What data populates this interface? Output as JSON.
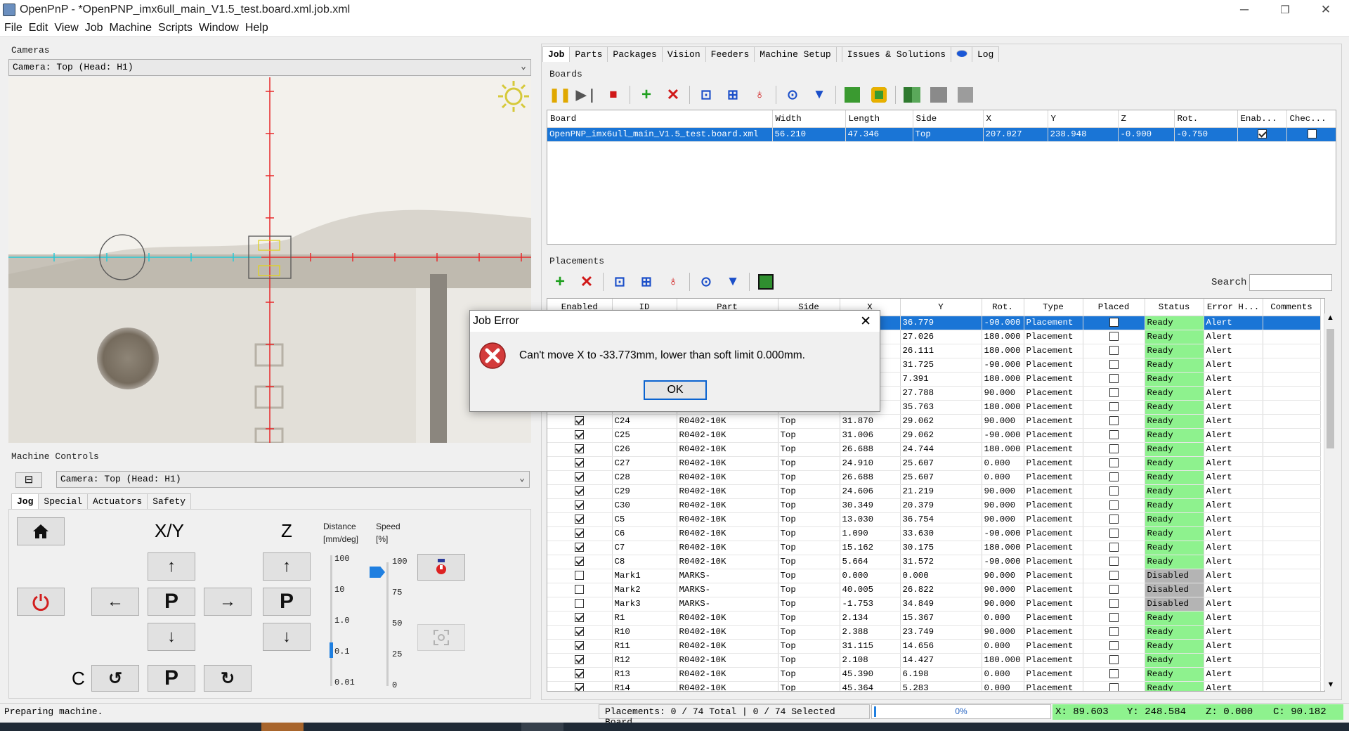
{
  "window": {
    "title": "OpenPnP - *OpenPNP_imx6ull_main_V1.5_test.board.xml.job.xml",
    "minimize": "─",
    "restore": "❐",
    "close": "✕"
  },
  "menu": [
    "File",
    "Edit",
    "View",
    "Job",
    "Machine",
    "Scripts",
    "Window",
    "Help"
  ],
  "cameras": {
    "section": "Cameras",
    "selected": "Camera: Top (Head: H1)"
  },
  "machine_controls": {
    "section": "Machine Controls",
    "camera": "Camera: Top (Head: H1)",
    "collapse": "⊟",
    "tabs": [
      "Jog",
      "Special",
      "Actuators",
      "Safety"
    ],
    "xy_label": "X/Y",
    "z_label": "Z",
    "c_label": "C",
    "park": "P",
    "distance_label": "Distance",
    "distance_unit": "[mm/deg]",
    "speed_label": "Speed",
    "speed_unit": "[%]",
    "distance_ticks": [
      "100",
      "10",
      "1.0",
      "0.1",
      "0.01"
    ],
    "distance_selected": "0.1",
    "speed_ticks": [
      "100",
      "75",
      "50",
      "25",
      "0"
    ],
    "speed_percent": 100
  },
  "right_tabs": [
    "Job",
    "Parts",
    "Packages",
    "Vision",
    "Feeders",
    "Machine Setup",
    "Issues & Solutions",
    "Log"
  ],
  "boards": {
    "section": "Boards",
    "columns": [
      "Board",
      "Width",
      "Length",
      "Side",
      "X",
      "Y",
      "Z",
      "Rot.",
      "Enab...",
      "Chec..."
    ],
    "rows": [
      {
        "board": "OpenPNP_imx6ull_main_V1.5_test.board.xml",
        "width": "56.210",
        "length": "47.346",
        "side": "Top",
        "x": "207.027",
        "y": "238.948",
        "z": "-0.900",
        "rot": "-0.750",
        "enabled": true,
        "check": false
      }
    ]
  },
  "placements": {
    "section": "Placements",
    "search_label": "Search",
    "search_value": "",
    "columns": [
      "Enabled",
      "ID",
      "Part",
      "Side",
      "X",
      "Y",
      "Rot.",
      "Type",
      "Placed",
      "Status",
      "Error H...",
      "Comments"
    ],
    "rows": [
      {
        "en": true,
        "id": "",
        "part": "",
        "side": "",
        "x": "",
        "y": "36.779",
        "rot": "-90.000",
        "type": "Placement",
        "placed": false,
        "status": "Ready",
        "err": "Alert",
        "selected": true
      },
      {
        "en": true,
        "id": "",
        "part": "",
        "side": "",
        "x": "",
        "y": "27.026",
        "rot": "180.000",
        "type": "Placement",
        "placed": false,
        "status": "Ready",
        "err": "Alert"
      },
      {
        "en": true,
        "id": "",
        "part": "",
        "side": "",
        "x": "",
        "y": "26.111",
        "rot": "180.000",
        "type": "Placement",
        "placed": false,
        "status": "Ready",
        "err": "Alert"
      },
      {
        "en": true,
        "id": "",
        "part": "",
        "side": "",
        "x": "",
        "y": "31.725",
        "rot": "-90.000",
        "type": "Placement",
        "placed": false,
        "status": "Ready",
        "err": "Alert"
      },
      {
        "en": true,
        "id": "",
        "part": "",
        "side": "",
        "x": "",
        "y": "7.391",
        "rot": "180.000",
        "type": "Placement",
        "placed": false,
        "status": "Ready",
        "err": "Alert"
      },
      {
        "en": true,
        "id": "",
        "part": "",
        "side": "",
        "x": "",
        "y": "27.788",
        "rot": "90.000",
        "type": "Placement",
        "placed": false,
        "status": "Ready",
        "err": "Alert"
      },
      {
        "en": true,
        "id": "",
        "part": "",
        "side": "",
        "x": "",
        "y": "35.763",
        "rot": "180.000",
        "type": "Placement",
        "placed": false,
        "status": "Ready",
        "err": "Alert"
      },
      {
        "en": true,
        "id": "C24",
        "part": "R0402-10K",
        "side": "Top",
        "x": "31.870",
        "y": "29.062",
        "rot": "90.000",
        "type": "Placement",
        "placed": false,
        "status": "Ready",
        "err": "Alert"
      },
      {
        "en": true,
        "id": "C25",
        "part": "R0402-10K",
        "side": "Top",
        "x": "31.006",
        "y": "29.062",
        "rot": "-90.000",
        "type": "Placement",
        "placed": false,
        "status": "Ready",
        "err": "Alert"
      },
      {
        "en": true,
        "id": "C26",
        "part": "R0402-10K",
        "side": "Top",
        "x": "26.688",
        "y": "24.744",
        "rot": "180.000",
        "type": "Placement",
        "placed": false,
        "status": "Ready",
        "err": "Alert"
      },
      {
        "en": true,
        "id": "C27",
        "part": "R0402-10K",
        "side": "Top",
        "x": "24.910",
        "y": "25.607",
        "rot": "0.000",
        "type": "Placement",
        "placed": false,
        "status": "Ready",
        "err": "Alert"
      },
      {
        "en": true,
        "id": "C28",
        "part": "R0402-10K",
        "side": "Top",
        "x": "26.688",
        "y": "25.607",
        "rot": "0.000",
        "type": "Placement",
        "placed": false,
        "status": "Ready",
        "err": "Alert"
      },
      {
        "en": true,
        "id": "C29",
        "part": "R0402-10K",
        "side": "Top",
        "x": "24.606",
        "y": "21.219",
        "rot": "90.000",
        "type": "Placement",
        "placed": false,
        "status": "Ready",
        "err": "Alert"
      },
      {
        "en": true,
        "id": "C30",
        "part": "R0402-10K",
        "side": "Top",
        "x": "30.349",
        "y": "20.379",
        "rot": "90.000",
        "type": "Placement",
        "placed": false,
        "status": "Ready",
        "err": "Alert"
      },
      {
        "en": true,
        "id": "C5",
        "part": "R0402-10K",
        "side": "Top",
        "x": "13.030",
        "y": "36.754",
        "rot": "90.000",
        "type": "Placement",
        "placed": false,
        "status": "Ready",
        "err": "Alert"
      },
      {
        "en": true,
        "id": "C6",
        "part": "R0402-10K",
        "side": "Top",
        "x": "1.090",
        "y": "33.630",
        "rot": "-90.000",
        "type": "Placement",
        "placed": false,
        "status": "Ready",
        "err": "Alert"
      },
      {
        "en": true,
        "id": "C7",
        "part": "R0402-10K",
        "side": "Top",
        "x": "15.162",
        "y": "30.175",
        "rot": "180.000",
        "type": "Placement",
        "placed": false,
        "status": "Ready",
        "err": "Alert"
      },
      {
        "en": true,
        "id": "C8",
        "part": "R0402-10K",
        "side": "Top",
        "x": "5.664",
        "y": "31.572",
        "rot": "-90.000",
        "type": "Placement",
        "placed": false,
        "status": "Ready",
        "err": "Alert"
      },
      {
        "en": false,
        "id": "Mark1",
        "part": "MARKS-",
        "side": "Top",
        "x": "0.000",
        "y": "0.000",
        "rot": "90.000",
        "type": "Placement",
        "placed": false,
        "status": "Disabled",
        "err": "Alert"
      },
      {
        "en": false,
        "id": "Mark2",
        "part": "MARKS-",
        "side": "Top",
        "x": "40.005",
        "y": "26.822",
        "rot": "90.000",
        "type": "Placement",
        "placed": false,
        "status": "Disabled",
        "err": "Alert"
      },
      {
        "en": false,
        "id": "Mark3",
        "part": "MARKS-",
        "side": "Top",
        "x": "-1.753",
        "y": "34.849",
        "rot": "90.000",
        "type": "Placement",
        "placed": false,
        "status": "Disabled",
        "err": "Alert"
      },
      {
        "en": true,
        "id": "R1",
        "part": "R0402-10K",
        "side": "Top",
        "x": "2.134",
        "y": "15.367",
        "rot": "0.000",
        "type": "Placement",
        "placed": false,
        "status": "Ready",
        "err": "Alert"
      },
      {
        "en": true,
        "id": "R10",
        "part": "R0402-10K",
        "side": "Top",
        "x": "2.388",
        "y": "23.749",
        "rot": "90.000",
        "type": "Placement",
        "placed": false,
        "status": "Ready",
        "err": "Alert"
      },
      {
        "en": true,
        "id": "R11",
        "part": "R0402-10K",
        "side": "Top",
        "x": "31.115",
        "y": "14.656",
        "rot": "0.000",
        "type": "Placement",
        "placed": false,
        "status": "Ready",
        "err": "Alert"
      },
      {
        "en": true,
        "id": "R12",
        "part": "R0402-10K",
        "side": "Top",
        "x": "2.108",
        "y": "14.427",
        "rot": "180.000",
        "type": "Placement",
        "placed": false,
        "status": "Ready",
        "err": "Alert"
      },
      {
        "en": true,
        "id": "R13",
        "part": "R0402-10K",
        "side": "Top",
        "x": "45.390",
        "y": "6.198",
        "rot": "0.000",
        "type": "Placement",
        "placed": false,
        "status": "Ready",
        "err": "Alert"
      },
      {
        "en": true,
        "id": "R14",
        "part": "R0402-10K",
        "side": "Top",
        "x": "45.364",
        "y": "5.283",
        "rot": "0.000",
        "type": "Placement",
        "placed": false,
        "status": "Ready",
        "err": "Alert"
      }
    ]
  },
  "dialog": {
    "title": "Job Error",
    "message": "Can't move X to -33.773mm, lower than soft limit 0.000mm.",
    "ok": "OK"
  },
  "statusbar": {
    "message": "Preparing machine.",
    "placements": "Placements: 0 / 74 Total | 0 / 74 Selected Board",
    "progress_text": "0%",
    "progress": 0,
    "x": "X: 89.603",
    "y": "Y: 248.584",
    "z": "Z: 0.000",
    "c": "C: 90.182"
  },
  "colors": {
    "selection": "#1a75d6",
    "ready": "#8ef28e",
    "disabled": "#b4b4b4",
    "coords_bg": "#8ef28e",
    "crosshair": "#e8292a",
    "reticle": "#27c9d6"
  }
}
